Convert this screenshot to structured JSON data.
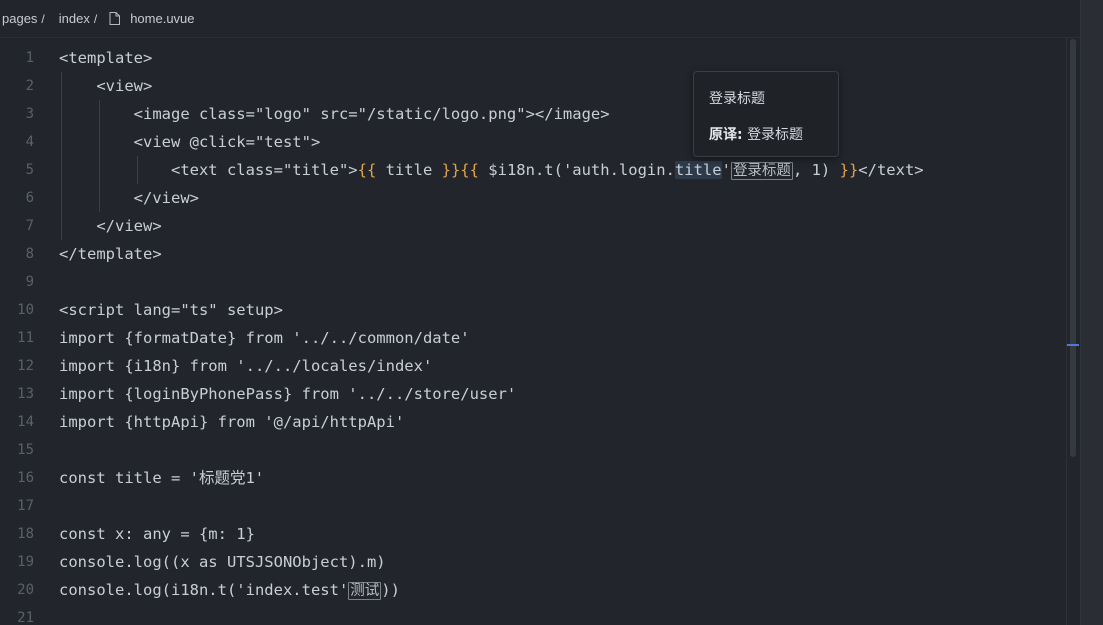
{
  "breadcrumb": {
    "items": [
      "pages",
      "index",
      "home.uvue"
    ]
  },
  "tooltip": {
    "title": "登录标题",
    "label": "原译:",
    "value": "登录标题"
  },
  "editor": {
    "lines": [
      {
        "n": "1",
        "segs": [
          {
            "t": "<template>"
          }
        ]
      },
      {
        "n": "2",
        "segs": [
          {
            "t": "    <view>"
          }
        ]
      },
      {
        "n": "3",
        "segs": [
          {
            "t": "        <image class=\"logo\" src=\"/static/logo.png\"></image>"
          }
        ]
      },
      {
        "n": "4",
        "segs": [
          {
            "t": "        <view @click=\"test\">"
          }
        ]
      },
      {
        "n": "5",
        "segs": [
          {
            "t": "            <text class=\"title\">"
          },
          {
            "t": "{{",
            "c": "br"
          },
          {
            "t": " title "
          },
          {
            "t": "}}{{",
            "c": "br"
          },
          {
            "t": " $i18n.t('auth.login."
          },
          {
            "t": "title",
            "c": "hl"
          },
          {
            "t": "'"
          },
          {
            "t": "登录标题",
            "c": "cn-box"
          },
          {
            "t": ", 1) "
          },
          {
            "t": "}}",
            "c": "br"
          },
          {
            "t": "</text>"
          }
        ]
      },
      {
        "n": "6",
        "segs": [
          {
            "t": "        </view>"
          }
        ]
      },
      {
        "n": "7",
        "segs": [
          {
            "t": "    </view>"
          }
        ]
      },
      {
        "n": "8",
        "segs": [
          {
            "t": "</template>"
          }
        ]
      },
      {
        "n": "9",
        "segs": [
          {
            "t": ""
          }
        ]
      },
      {
        "n": "10",
        "segs": [
          {
            "t": "<script lang=\"ts\" setup>"
          }
        ]
      },
      {
        "n": "11",
        "segs": [
          {
            "t": "import {formatDate} from '../../common/date'"
          }
        ]
      },
      {
        "n": "12",
        "segs": [
          {
            "t": "import {i18n} from '../../locales/index'"
          }
        ]
      },
      {
        "n": "13",
        "segs": [
          {
            "t": "import {loginByPhonePass} from '../../store/user'"
          }
        ]
      },
      {
        "n": "14",
        "segs": [
          {
            "t": "import {httpApi} from '@/api/httpApi'"
          }
        ]
      },
      {
        "n": "15",
        "segs": [
          {
            "t": ""
          }
        ]
      },
      {
        "n": "16",
        "segs": [
          {
            "t": "const title = '标题党1'"
          }
        ]
      },
      {
        "n": "17",
        "segs": [
          {
            "t": ""
          }
        ]
      },
      {
        "n": "18",
        "segs": [
          {
            "t": "const x: any = {m: 1}"
          }
        ]
      },
      {
        "n": "19",
        "segs": [
          {
            "t": "console.log((x as UTSJSONObject).m)"
          }
        ]
      },
      {
        "n": "20",
        "segs": [
          {
            "t": "console.log(i18n.t('index.test'"
          },
          {
            "t": "测试",
            "c": "cn-box"
          },
          {
            "t": "))"
          }
        ]
      },
      {
        "n": "21",
        "segs": [
          {
            "t": ""
          }
        ]
      }
    ]
  }
}
